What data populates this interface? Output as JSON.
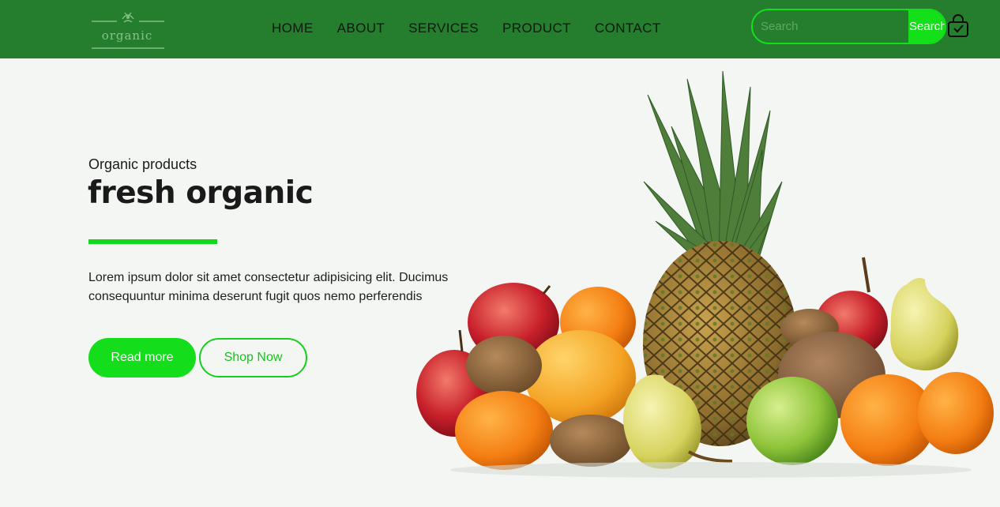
{
  "header": {
    "logo_text": "organic",
    "nav": [
      "HOME",
      "ABOUT",
      "SERVICES",
      "PRODUCT",
      "CONTACT"
    ],
    "search": {
      "placeholder": "Search",
      "button_label": "Search"
    }
  },
  "hero": {
    "subtitle": "Organic products",
    "title": "fresh organic",
    "description": "Lorem ipsum dolor sit amet consectetur adipisicing elit. Ducimus consequuntur minima deserunt fugit quos nemo perferendis",
    "read_more_label": "Read more",
    "shop_now_label": "Shop Now"
  },
  "colors": {
    "header_bg": "#257d2e",
    "accent_green": "#14e01a",
    "page_bg": "#f3f6f2",
    "text_dark": "#1a1a1a"
  },
  "icons": [
    "logo-emblem-icon",
    "shopping-bag-icon"
  ]
}
